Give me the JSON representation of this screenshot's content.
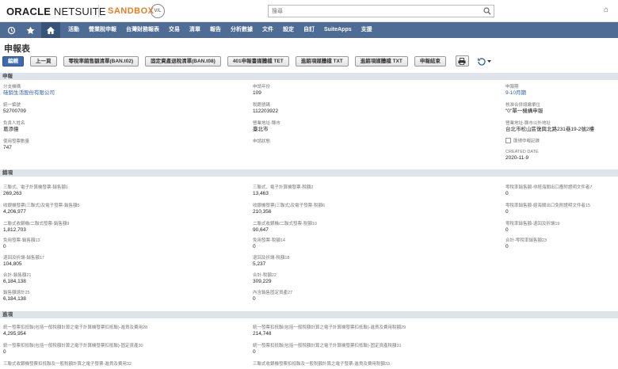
{
  "header": {
    "logo_oracle": "ORACLE",
    "logo_netsuite": "NETSUITE",
    "sandbox": "SANDBOX",
    "badge": "V/L",
    "search_placeholder": "搜尋"
  },
  "nav": {
    "items": [
      "活動",
      "營業稅申報",
      "台灣財務報表",
      "交易",
      "清單",
      "報告",
      "分析數據",
      "文件",
      "設定",
      "自訂",
      "SuiteApps",
      "支援"
    ]
  },
  "page": {
    "title": "申報表",
    "toolbar": {
      "edit": "編輯",
      "previous": "上一頁",
      "btn1": "零稅率銷售額清單(BAN.t02)",
      "btn2": "固定資產退稅清單(BAN.t08)",
      "btn3": "401申報書媒體檔 TET",
      "btn4": "進銷項媒體檔 TXT",
      "btn5": "進銷項媒體檔 TXT",
      "btn6": "申報結束"
    }
  },
  "sections": {
    "primary": "申報",
    "sales": "銷項",
    "input": "進項"
  },
  "primary": {
    "subsidiary_label": "分支機構",
    "subsidiary_value": "硅銷生活股份有限公司",
    "tax_id_label": "統一編號",
    "tax_id_value": "52700709",
    "owner_label": "負責人姓名",
    "owner_value": "葛添億",
    "invoices_label": "使用發票數量",
    "invoices_value": "747",
    "year_label": "申請年份",
    "year_value": "109",
    "tax_reg_label": "稅籍號碼",
    "tax_reg_value": "112203922",
    "city_label": "營業地址-縣市",
    "city_value": "臺北市",
    "status_label": "申請狀態",
    "status_value": "",
    "period_label": "申報期",
    "period_value": "9-10月期",
    "type_label": "核准合併總繳單位",
    "type_value": "\"0\"單一機構申報",
    "address_label": "營業地址-縣市以外地址",
    "address_value": "台北市松山區復興北路231巷19-2號2樓",
    "checkbox_label": "匯總申報記錄",
    "created_label": "CREATED DATE",
    "created_value": "2020-11-9"
  },
  "sales": [
    {
      "label": "三聯式、電子計算機發票-銷售額1",
      "value": "269,263"
    },
    {
      "label": "三聯式、電子計算機發票-稅額2",
      "value": "13,463"
    },
    {
      "label": "零稅率銷售額-非經海關出口應附證明文件者7",
      "value": "0"
    },
    {
      "label": "收銀機發票(三聯式)及電子發票-銷售額5",
      "value": "4,206,977"
    },
    {
      "label": "收銀機發票(三聯式)及電子發票-稅額6",
      "value": "210,356"
    },
    {
      "label": "零稅率銷售額-經海關出口免附證明文件者15",
      "value": "0"
    },
    {
      "label": "二聯式收銀機/二聯式發票-銷售額9",
      "value": "1,812,703"
    },
    {
      "label": "二聯式收銀機/二聯式發票-稅額10",
      "value": "90,647"
    },
    {
      "label": "零稅率銷售額-退回及折讓19",
      "value": "0"
    },
    {
      "label": "免用發票-銷售額13",
      "value": "0"
    },
    {
      "label": "免用發票-稅額14",
      "value": "0"
    },
    {
      "label": "合計-零稅率銷售額23",
      "value": "0"
    },
    {
      "label": "退回及折讓-銷售額17",
      "value": "104,805"
    },
    {
      "label": "退回及折讓-稅額18",
      "value": "5,237"
    },
    {
      "label": "合計-銷售額21",
      "value": "6,184,138"
    },
    {
      "label": "合計-稅額22",
      "value": "309,229"
    },
    {
      "label": "銷售額總計25",
      "value": "6,184,138"
    },
    {
      "label": "內含銷售固定資產27",
      "value": "0"
    }
  ],
  "input": [
    {
      "label": "統一發票扣抵聯(包括一般稅額計算之電子計算機發票扣抵聯)-進貨及費用28",
      "value": "4,295,954"
    },
    {
      "label": "統一發票扣抵聯(包括一般稅額計算之電子計算機發票扣抵聯)-進貨及費用稅額29",
      "value": "214,748"
    },
    {
      "label": "統一發票扣抵聯(包括一般稅額計算之電子計算機發票扣抵聯)-固定資產30",
      "value": "0"
    },
    {
      "label": "統一發票扣抵聯(包括一般稅額計算之電子計算機發票扣抵聯)-固定資產稅額31",
      "value": "0"
    },
    {
      "label": "三聯式收銀機發票扣抵聯及一般稅額計算之電子發票-進貨及費用32",
      "value": ""
    },
    {
      "label": "三聯式收銀機發票扣抵聯及一般稅額計算之電子發票-進貨及費用稅額33",
      "value": ""
    }
  ]
}
